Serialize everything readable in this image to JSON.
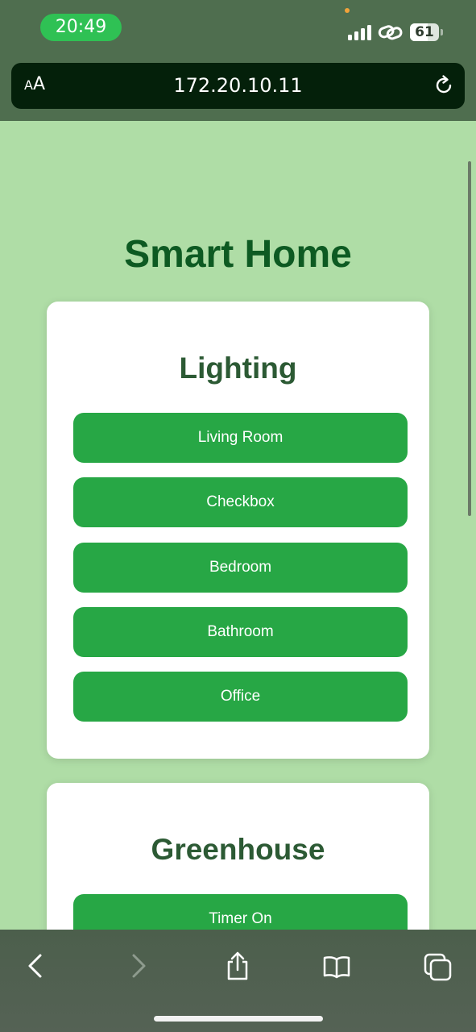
{
  "status_bar": {
    "time": "20:49",
    "battery": "61",
    "battery_level": 0.61,
    "icons": [
      "signal-icon",
      "link-icon",
      "battery-icon"
    ]
  },
  "browser": {
    "text_size_label_small": "A",
    "text_size_label_large": "A",
    "url": "172.20.10.11",
    "icons": [
      "reload-icon"
    ]
  },
  "page": {
    "title": "Smart Home",
    "lighting": {
      "title": "Lighting",
      "buttons": [
        "Living Room",
        "Checkbox",
        "Bedroom",
        "Bathroom",
        "Office"
      ]
    },
    "greenhouse": {
      "title": "Greenhouse",
      "buttons": [
        "Timer On"
      ]
    }
  },
  "toolbar": {
    "icons": [
      "back-arrow-icon",
      "forward-arrow-icon",
      "share-icon",
      "bookmarks-icon",
      "tabs-icon"
    ]
  },
  "colors": {
    "page_background": "#afdda6",
    "title": "#0d5a22",
    "button": "#27a745",
    "card_title": "#2c5a34",
    "time_pill": "#2fc154"
  }
}
